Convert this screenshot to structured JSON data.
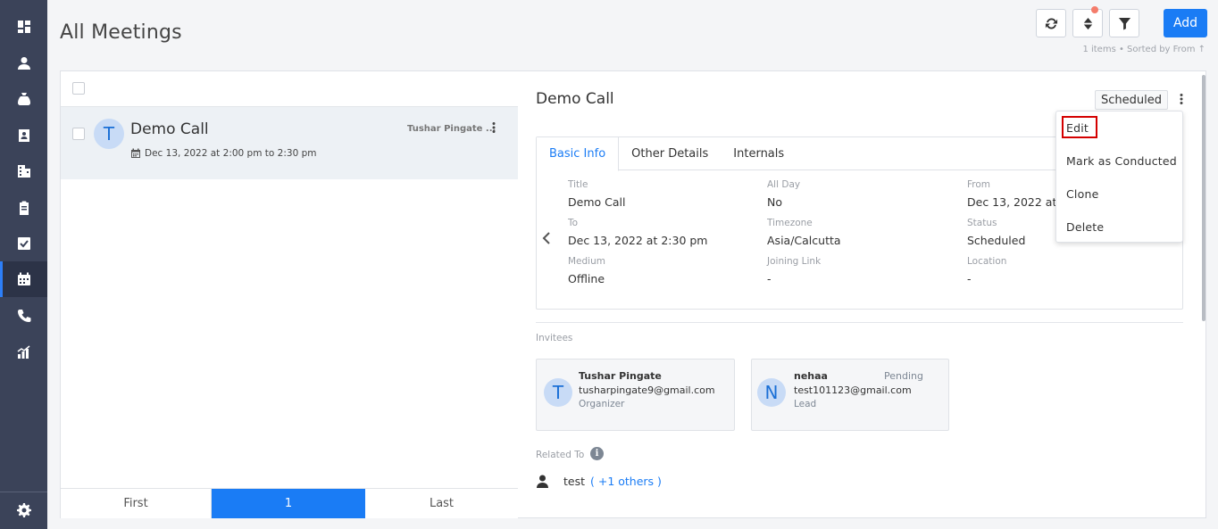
{
  "page": {
    "title": "All Meetings",
    "sort_info": "1 items • Sorted by  From ↑",
    "add_label": "Add"
  },
  "colors": {
    "accent": "#1a7cf5",
    "sidebar": "#3b4359",
    "highlight": "#d40000"
  },
  "sidebar": {
    "items": [
      {
        "name": "dashboard-icon"
      },
      {
        "name": "contacts-icon"
      },
      {
        "name": "deals-icon"
      },
      {
        "name": "address-book-icon"
      },
      {
        "name": "companies-icon"
      },
      {
        "name": "clipboard-icon"
      },
      {
        "name": "tasks-icon"
      },
      {
        "name": "meetings-calendar-icon"
      },
      {
        "name": "calls-phone-icon"
      },
      {
        "name": "reports-icon"
      },
      {
        "name": "settings-gear-icon"
      }
    ]
  },
  "list": {
    "item": {
      "avatar": "T",
      "title": "Demo Call",
      "owner": "Tushar Pingate ...",
      "date": "Dec 13, 2022 at 2:00 pm to 2:30 pm"
    },
    "pager": {
      "first": "First",
      "current": "1",
      "last": "Last"
    }
  },
  "detail": {
    "title": "Demo Call",
    "status": "Scheduled",
    "tabs": [
      "Basic Info",
      "Other Details",
      "Internals"
    ],
    "fields": {
      "title": {
        "label": "Title",
        "value": "Demo Call"
      },
      "all_day": {
        "label": "All Day",
        "value": "No"
      },
      "from": {
        "label": "From",
        "value": "Dec 13, 2022 at 2"
      },
      "to": {
        "label": "To",
        "value": "Dec 13, 2022 at 2:30 pm"
      },
      "timezone": {
        "label": "Timezone",
        "value": "Asia/Calcutta"
      },
      "status": {
        "label": "Status",
        "value": "Scheduled"
      },
      "medium": {
        "label": "Medium",
        "value": "Offline"
      },
      "joining_link": {
        "label": "Joining Link",
        "value": "-"
      },
      "location": {
        "label": "Location",
        "value": "-"
      }
    },
    "invitees_label": "Invitees",
    "invitees": [
      {
        "avatar": "T",
        "name": "Tushar Pingate",
        "email": "tusharpingate9@gmail.com",
        "role": "Organizer",
        "status": ""
      },
      {
        "avatar": "N",
        "name": "nehaa",
        "email": "test101123@gmail.com",
        "role": "Lead",
        "status": "Pending"
      }
    ],
    "related_label": "Related To",
    "related": {
      "text": "test",
      "link": "( +1 others )"
    }
  },
  "menu": {
    "items": [
      "Edit",
      "Mark as Conducted",
      "Clone",
      "Delete"
    ]
  }
}
